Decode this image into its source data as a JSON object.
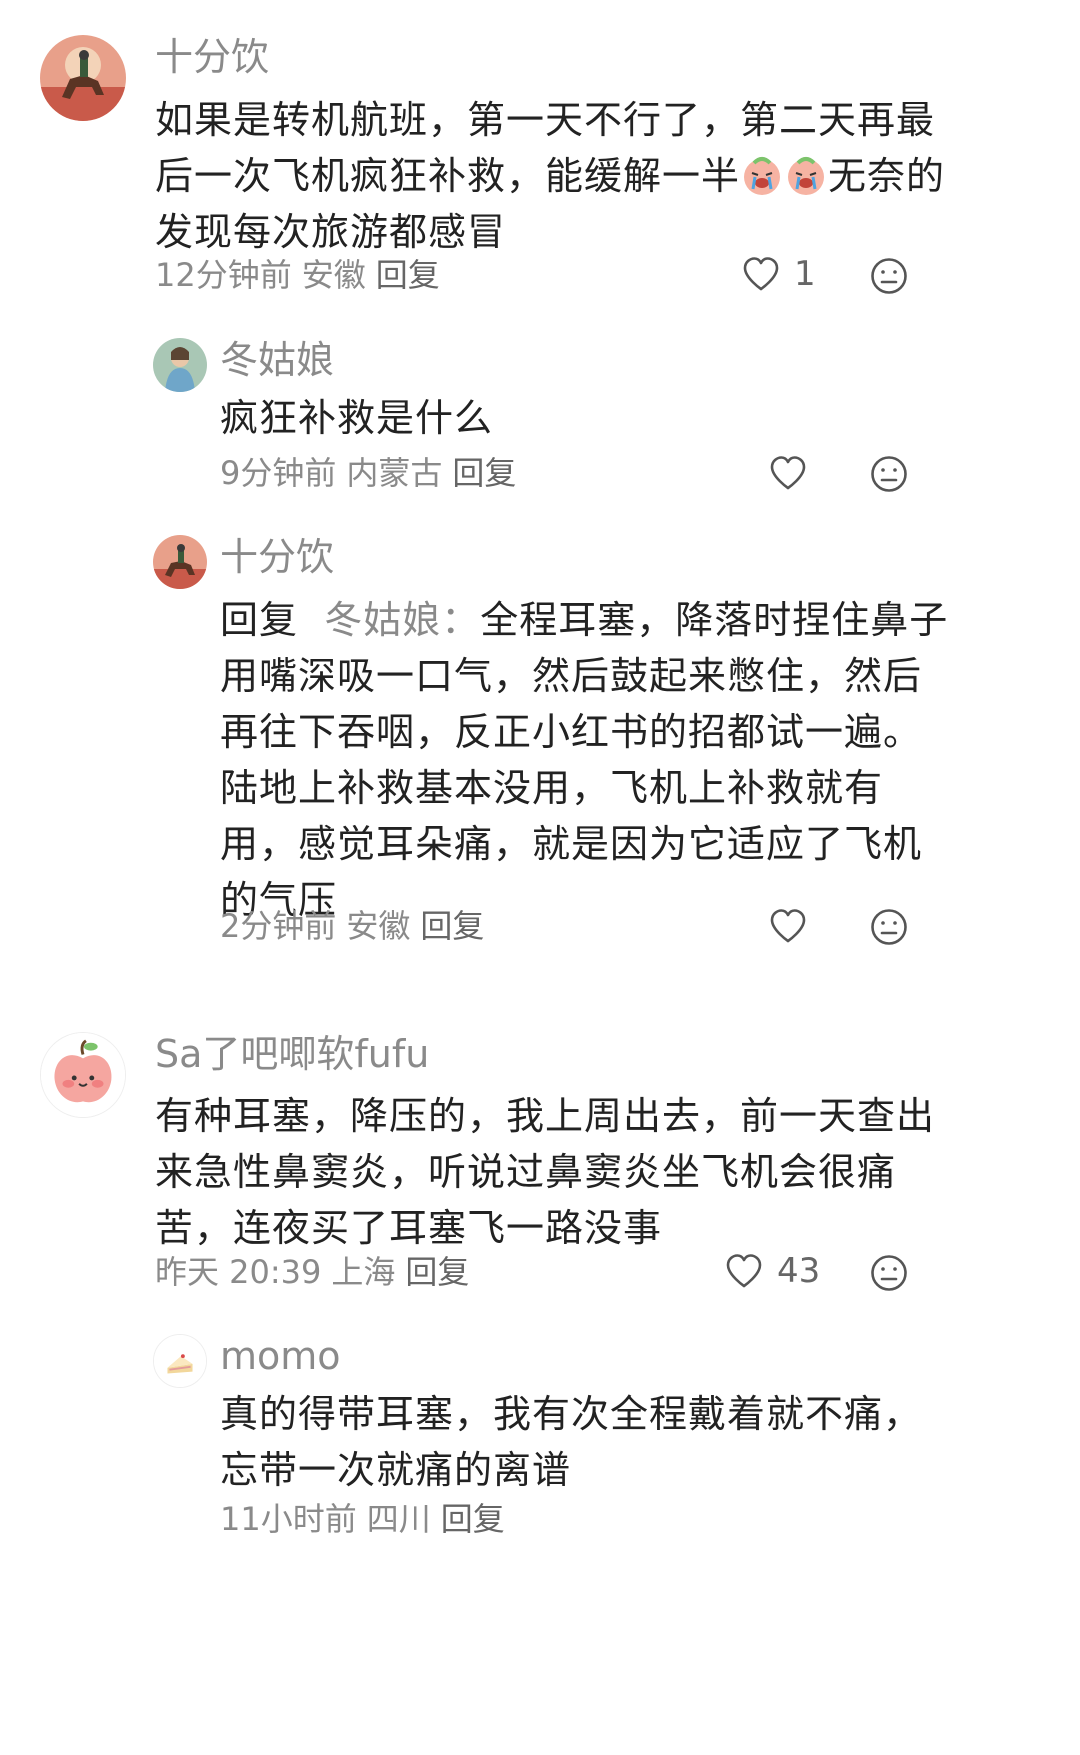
{
  "comments": [
    {
      "username": "十分饮",
      "content_lines": [
        "如果是转机航班，第一天不行了，第二天再最",
        "后一次飞机疯狂补救，能缓解一半",
        "无奈的",
        "发现每次旅游都感冒"
      ],
      "time": "12分钟前",
      "location": "安徽",
      "reply_label": "回复",
      "likes": "1",
      "replies": [
        {
          "username": "冬姑娘",
          "content_lines": [
            "疯狂补救是什么"
          ],
          "time": "9分钟前",
          "location": "内蒙古",
          "reply_label": "回复"
        },
        {
          "username": "十分饮",
          "reply_prefix": "回复",
          "mention": "冬姑娘：",
          "content_lines": [
            "全程耳塞，降落时捏住鼻子",
            "用嘴深吸一口气，然后鼓起来憋住，然后",
            "再往下吞咽，反正小红书的招都试一遍。",
            "陆地上补救基本没用，飞机上补救就有",
            "用，感觉耳朵痛，就是因为它适应了飞机",
            "的气压"
          ],
          "time": "2分钟前",
          "location": "安徽",
          "reply_label": "回复"
        }
      ]
    },
    {
      "username": "Sa了吧唧软fufu",
      "content_lines": [
        "有种耳塞，降压的，我上周出去，前一天查出",
        "来急性鼻窦炎，听说过鼻窦炎坐飞机会很痛",
        "苦，连夜买了耳塞飞一路没事"
      ],
      "time": "昨天 20:39",
      "location": "上海",
      "reply_label": "回复",
      "likes": "43",
      "replies": [
        {
          "username": "momo",
          "content_lines": [
            "真的得带耳塞，我有次全程戴着就不痛，",
            "忘带一次就痛的离谱"
          ],
          "time": "11小时前",
          "location": "四川",
          "reply_label": "回复"
        }
      ]
    }
  ],
  "icons": {
    "like": "heart-outline-icon",
    "dislike": "neutral-face-icon",
    "emoji": "crying-face-emoji"
  },
  "colors": {
    "text": "#222222",
    "secondary": "#8a8a8a",
    "icon": "#555555"
  }
}
